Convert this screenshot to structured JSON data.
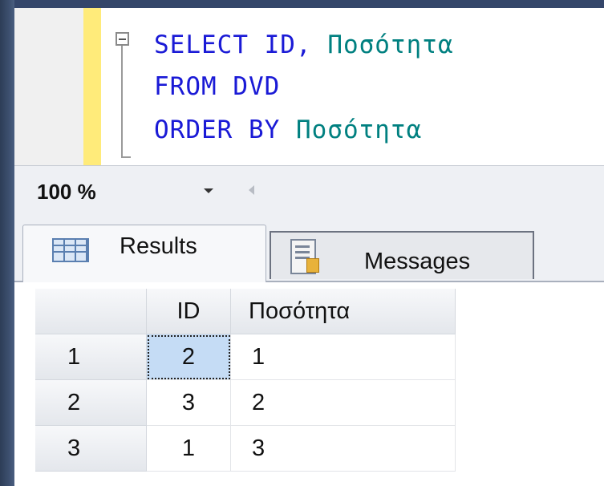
{
  "editor": {
    "line1": {
      "kw": "SELECT",
      "rest_plain": " ID, ",
      "rest_id": "Ποσότητα"
    },
    "line2": {
      "kw1": "FROM",
      "plain": " DVD"
    },
    "line3": {
      "kw": "ORDER BY",
      "id": " Ποσότητα"
    }
  },
  "zoom": {
    "value": "100 %"
  },
  "tabs": [
    {
      "label": "Results",
      "icon": "grid-icon"
    },
    {
      "label": "Messages",
      "icon": "messages-icon"
    }
  ],
  "results": {
    "columns": [
      "",
      "ID",
      "Ποσότητα"
    ],
    "rows": [
      {
        "num": "1",
        "id": "2",
        "qty": "1"
      },
      {
        "num": "2",
        "id": "3",
        "qty": "2"
      },
      {
        "num": "3",
        "id": "1",
        "qty": "3"
      }
    ]
  },
  "colors": {
    "keyword": "#1a1ad6",
    "identifier": "#008080",
    "selection": "#c5dcf5"
  }
}
